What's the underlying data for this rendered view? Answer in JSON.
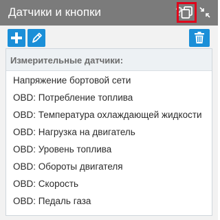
{
  "panel": {
    "title": "Датчики и кнопки",
    "help_symbol": "?",
    "section_title": "Измерительные датчики:",
    "items": [
      "Напряжение бортовой сети",
      "OBD: Потребление топлива",
      "OBD: Температура охлаждающей жидкости",
      "OBD: Нагрузка на двигатель",
      "OBD: Уровень топлива",
      "OBD: Обороты двигателя",
      "OBD: Скорость",
      "OBD: Педаль газа"
    ]
  },
  "colors": {
    "header_bg": "#7b7b7b",
    "accent": "#1b8fd8",
    "highlight": "#e0001a",
    "panel_bg": "#f2f2f2"
  },
  "icons": [
    "help-icon",
    "copy-icon",
    "collapse-icon",
    "plus-icon",
    "pen-icon",
    "trash-icon"
  ]
}
